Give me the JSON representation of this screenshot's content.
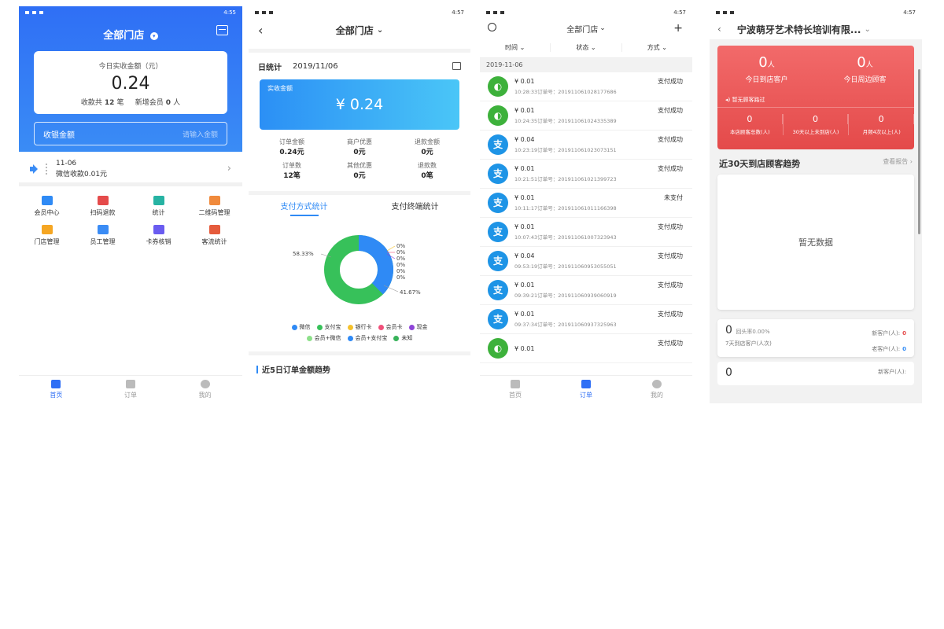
{
  "status": {
    "p1_time": "4:55",
    "p2_time": "4:57",
    "p3_time": "4:57",
    "p4_time": "4:57"
  },
  "phone1": {
    "title": "全部门店",
    "card_label": "今日实收金额（元）",
    "amount": "0.24",
    "count_prefix": "收款共",
    "count": "12",
    "count_unit": "笔",
    "member_prefix": "新增会员",
    "member_count": "0",
    "member_unit": "人",
    "input_label": "收银金额",
    "input_placeholder": "请输入金额",
    "notice_date": "11-06",
    "notice_text": "微信收款0.01元",
    "menu": [
      {
        "label": "会员中心",
        "color": "#2f8af5"
      },
      {
        "label": "扫码退款",
        "color": "#e54b4b"
      },
      {
        "label": "统计",
        "color": "#27b3a3"
      },
      {
        "label": "二维码管理",
        "color": "#f08a3c"
      },
      {
        "label": "门店管理",
        "color": "#f5a623"
      },
      {
        "label": "员工管理",
        "color": "#3b8cf5"
      },
      {
        "label": "卡券核销",
        "color": "#6a5cf0"
      },
      {
        "label": "客流统计",
        "color": "#e55b3c"
      }
    ],
    "tabs": [
      "首页",
      "订单",
      "我的"
    ]
  },
  "phone2": {
    "title": "全部门店",
    "date_label": "日统计",
    "date": "2019/11/06",
    "card_label": "实收金额",
    "card_amount": "¥ 0.24",
    "stats": [
      {
        "k": "订单金额",
        "v": "0.24元"
      },
      {
        "k": "商户优惠",
        "v": "0元"
      },
      {
        "k": "退款金额",
        "v": "0元"
      },
      {
        "k": "订单数",
        "v": "12笔"
      },
      {
        "k": "其他优惠",
        "v": "0元"
      },
      {
        "k": "退款数",
        "v": "0笔"
      }
    ],
    "tab_a": "支付方式统计",
    "tab_b": "支付终端统计",
    "pct_left": "58.33%",
    "pct_right": "41.67%",
    "pct_zero": "0%",
    "legend": [
      {
        "label": "微信",
        "color": "#2f8af5"
      },
      {
        "label": "支付宝",
        "color": "#37c15a"
      },
      {
        "label": "银行卡",
        "color": "#f5c12c"
      },
      {
        "label": "会员卡",
        "color": "#f0507a"
      },
      {
        "label": "现金",
        "color": "#8e44d8"
      },
      {
        "label": "会员+微信",
        "color": "#8de08a"
      },
      {
        "label": "会员+支付宝",
        "color": "#2f8af5"
      },
      {
        "label": "未知",
        "color": "#37b25a"
      }
    ],
    "trend_title": "近5日订单金额趋势"
  },
  "phone3": {
    "title": "全部门店",
    "filters": [
      "时间",
      "状态",
      "方式"
    ],
    "date": "2019-11-06",
    "order_prefix": "订单号：",
    "orders": [
      {
        "type": "wx",
        "amount": "¥ 0.01",
        "time": "10:28:33",
        "no": "201911061028177686",
        "status": "支付成功"
      },
      {
        "type": "wx",
        "amount": "¥ 0.01",
        "time": "10:24:35",
        "no": "201911061024335389",
        "status": "支付成功"
      },
      {
        "type": "ali",
        "amount": "¥ 0.04",
        "time": "10:23:19",
        "no": "201911061023073151",
        "status": "支付成功"
      },
      {
        "type": "ali",
        "amount": "¥ 0.01",
        "time": "10:21:51",
        "no": "201911061021399723",
        "status": "支付成功"
      },
      {
        "type": "ali",
        "amount": "¥ 0.01",
        "time": "10:11:17",
        "no": "201911061011166398",
        "status": "未支付"
      },
      {
        "type": "ali",
        "amount": "¥ 0.01",
        "time": "10:07:43",
        "no": "201911061007323943",
        "status": "支付成功"
      },
      {
        "type": "ali",
        "amount": "¥ 0.04",
        "time": "09:53:19",
        "no": "201911060953055051",
        "status": "支付成功"
      },
      {
        "type": "ali",
        "amount": "¥ 0.01",
        "time": "09:39:21",
        "no": "201911060939060919",
        "status": "支付成功"
      },
      {
        "type": "ali",
        "amount": "¥ 0.01",
        "time": "09:37:34",
        "no": "201911060937325963",
        "status": "支付成功"
      },
      {
        "type": "wx",
        "amount": "¥ 0.01",
        "time": "",
        "no": "",
        "status": "支付成功"
      }
    ],
    "tabs": [
      "首页",
      "订单",
      "我的"
    ]
  },
  "phone4": {
    "title": "宁波萌牙艺术特长培训有限...",
    "today_visitors": "0",
    "today_visitors_unit": "人",
    "today_visitors_label": "今日到店客户",
    "nearby": "0",
    "nearby_unit": "人",
    "nearby_label": "今日周边顾客",
    "notice": "暂无顾客路过",
    "small": [
      {
        "n": "0",
        "k": "本店顾客总数(人)"
      },
      {
        "n": "0",
        "k": "30天以上未到店(人)"
      },
      {
        "n": "0",
        "k": "月频4次以上(人)"
      }
    ],
    "trend_title": "近30天到店顾客趋势",
    "report_link": "查看报告",
    "empty": "暂无数据",
    "repeat_n": "0",
    "repeat_rate": "回头率0.00%",
    "repeat_label": "7天到店客户(人次)",
    "new_label": "新客户(人):",
    "new_n": "0",
    "old_label": "老客户(人):",
    "old_n": "0",
    "card2_n": "0",
    "card2_label": "新客户(人):"
  }
}
